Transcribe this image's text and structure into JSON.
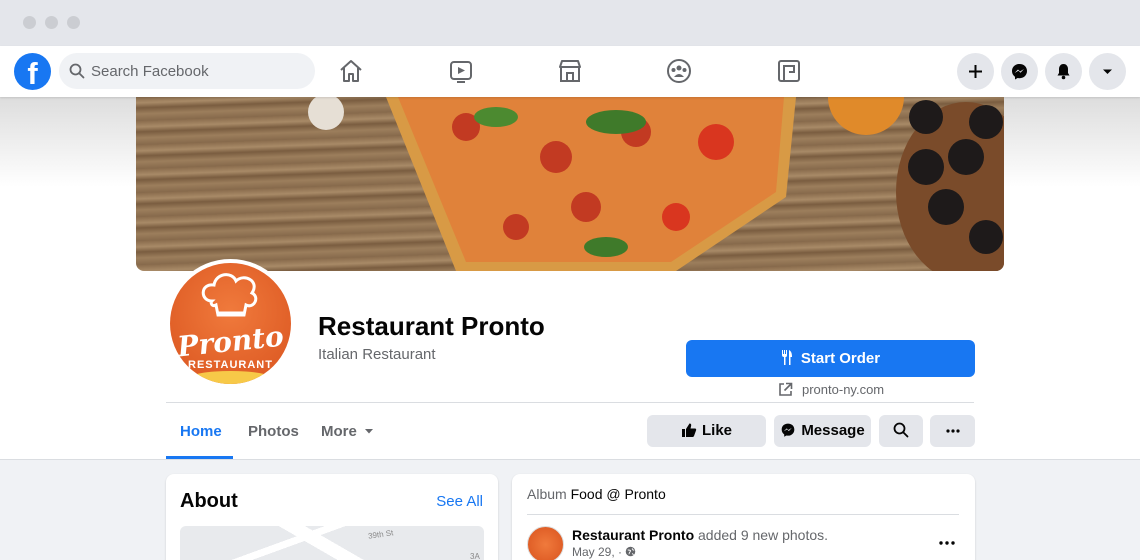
{
  "search": {
    "placeholder": "Search Facebook"
  },
  "topnav": {
    "icons": [
      "home-icon",
      "watch-icon",
      "marketplace-icon",
      "groups-icon",
      "gaming-icon"
    ],
    "right_buttons": [
      "create-plus-icon",
      "messenger-icon",
      "notifications-bell-icon",
      "account-menu-caret-icon"
    ]
  },
  "page": {
    "name": "Restaurant Pronto",
    "category": "Italian Restaurant",
    "avatar_text": "Pronto",
    "avatar_subtext": "RESTAURANT",
    "cta_label": "Start Order",
    "website": "pronto-ny.com"
  },
  "tabs": [
    {
      "label": "Home",
      "active": true
    },
    {
      "label": "Photos",
      "active": false
    },
    {
      "label": "More",
      "active": false
    }
  ],
  "actions": {
    "like": "Like",
    "message": "Message"
  },
  "about": {
    "title": "About",
    "see_all": "See All",
    "map_street": "39th St",
    "map_avenue": "3A"
  },
  "post": {
    "album_prefix": "Album",
    "album_name": "Food @ Pronto",
    "author": "Restaurant Pronto",
    "action_text": "added 9 new photos.",
    "date": "May 29, ·"
  },
  "colors": {
    "brand_blue": "#1877f2",
    "background": "#f0f2f5",
    "avatar_orange": "#e8652a"
  }
}
